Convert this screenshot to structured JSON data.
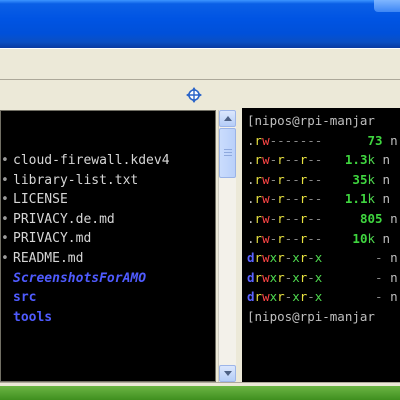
{
  "files": [
    {
      "name": "cloud-firewall.kdev4",
      "kind": "file"
    },
    {
      "name": "library-list.txt",
      "kind": "file"
    },
    {
      "name": "LICENSE",
      "kind": "file"
    },
    {
      "name": "PRIVACY.de.md",
      "kind": "file"
    },
    {
      "name": "PRIVACY.md",
      "kind": "file"
    },
    {
      "name": "README.md",
      "kind": "file"
    },
    {
      "name": "ScreenshotsForAMO",
      "kind": "dir"
    },
    {
      "name": "src",
      "kind": "dir"
    },
    {
      "name": "tools",
      "kind": "dir"
    }
  ],
  "terminal": {
    "prompt": "[nipos@rpi-manjar",
    "lines": [
      {
        "perm_type": ".",
        "perm": "rw-------",
        "size": "73",
        "unit": "",
        "tail": "n"
      },
      {
        "perm_type": ".",
        "perm": "rw-r--r--",
        "size": "1.3",
        "unit": "k",
        "tail": "n"
      },
      {
        "perm_type": ".",
        "perm": "rw-r--r--",
        "size": "35",
        "unit": "k",
        "tail": "n"
      },
      {
        "perm_type": ".",
        "perm": "rw-r--r--",
        "size": "1.1",
        "unit": "k",
        "tail": "n"
      },
      {
        "perm_type": ".",
        "perm": "rw-r--r--",
        "size": "805",
        "unit": "",
        "tail": "n"
      },
      {
        "perm_type": ".",
        "perm": "rw-r--r--",
        "size": "10",
        "unit": "k",
        "tail": "n"
      },
      {
        "perm_type": "d",
        "perm": "rwxr-xr-x",
        "size": "-",
        "unit": "",
        "tail": "n"
      },
      {
        "perm_type": "d",
        "perm": "rwxr-xr-x",
        "size": "-",
        "unit": "",
        "tail": "n"
      },
      {
        "perm_type": "d",
        "perm": "rwxr-xr-x",
        "size": "-",
        "unit": "",
        "tail": "n"
      }
    ],
    "prompt_end": "[nipos@rpi-manjar"
  },
  "colors": {
    "titlebar": "#0054e3",
    "terminal_bg": "#000000",
    "dir_blue": "#4f5bff",
    "size_green": "#4ed84e",
    "perm_yellow": "#e8e140",
    "perm_red": "#ff4646",
    "taskbar_green": "#4f9f2c"
  },
  "icons": {
    "dock": "dock-restore-icon",
    "bullet": "file-bullet-icon"
  }
}
